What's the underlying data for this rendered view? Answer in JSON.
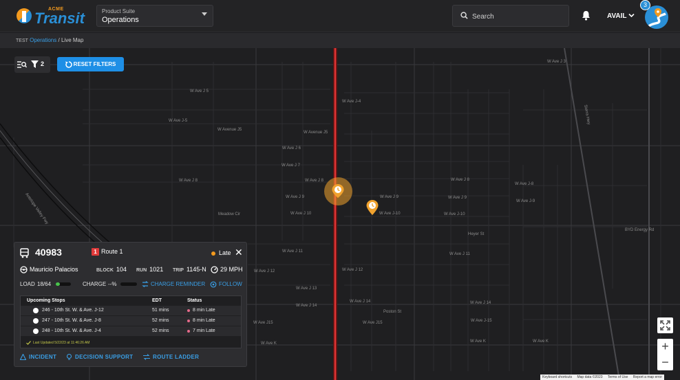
{
  "header": {
    "brand_small": "ACME",
    "brand_large": "Transit",
    "suite_label": "Product Suite",
    "suite_value": "Operations",
    "search_placeholder": "Search",
    "user_status": "AVAIL",
    "notification_badge": "3"
  },
  "breadcrumb": {
    "prefix": "TEST",
    "parent": "Operations",
    "separator": "/",
    "current": "Live Map"
  },
  "map_toolbar": {
    "filter_count": "2",
    "reset_label": "RESET FILTERS"
  },
  "map": {
    "street_labels": [
      "W Ave J 3",
      "W Ave J-4",
      "W Ave J 5",
      "W Ave J-5",
      "W Avenue J5",
      "W Avenue J5",
      "W Ave J 6",
      "W Ave J 7",
      "W Ave J 8",
      "W Ave J 8",
      "W Ave J 8",
      "W Ave J-8",
      "W Ave J 9",
      "W Ave J 9",
      "W Ave J 9",
      "W Ave J-9",
      "W Ave J 10",
      "W Ave J-10",
      "W Ave J-10",
      "Meadow Cir",
      "Heyer St",
      "BYD Energy Rd",
      "W Ave J 11",
      "W Ave J 11",
      "W Ave J 12",
      "W Ave J 12",
      "W Ave J 13",
      "W Ave J 14",
      "W Ave J 14",
      "W Ave J 14",
      "Poston St",
      "W Ave J15",
      "W Ave J15",
      "W Ave J-15",
      "W Ave K",
      "W Ave K",
      "W Ave K",
      "Antelope Valley Fwy",
      "Sierra Hwy"
    ],
    "attribution": [
      "Keyboard shortcuts",
      "Map data ©2023",
      "Terms of Use",
      "Report a map error"
    ],
    "zoom_in": "+",
    "zoom_out": "−"
  },
  "vehicle_panel": {
    "vehicle_id": "40983",
    "route_number": "1",
    "route_label": "Route 1",
    "status": "Late",
    "driver": "Mauricio Palacios",
    "block_label": "BLOCK",
    "block_value": "104",
    "run_label": "RUN",
    "run_value": "1021",
    "trip_label": "TRIP",
    "trip_value": "1145-N",
    "speed": "29 MPH",
    "load_label": "LOAD",
    "load_value": "18/64",
    "load_fraction": 0.28,
    "charge_label": "CHARGE",
    "charge_value": "--%",
    "charge_reminder_label": "CHARGE REMINDER",
    "follow_label": "FOLLOW",
    "stops_headers": {
      "stop": "Upcoming Stops",
      "edt": "EDT",
      "status": "Status"
    },
    "stops": [
      {
        "stop": "246 - 10th St. W. & Ave. J-12",
        "edt": "51 mins",
        "status": "8 min Late"
      },
      {
        "stop": "247 - 10th St. W. & Ave. J-8",
        "edt": "52 mins",
        "status": "8 min Late"
      },
      {
        "stop": "248 - 10th St. W. & Ave. J-4",
        "edt": "52 mins",
        "status": "7 min Late"
      }
    ],
    "last_updated": "Last Updated 5/22/23 at 11:46:26 AM",
    "actions": {
      "incident": "INCIDENT",
      "decision_support": "DECISION SUPPORT",
      "route_ladder": "ROUTE LADDER"
    }
  },
  "colors": {
    "accent": "#1e8fe6",
    "route": "#e03a3a",
    "late": "#f39a1e",
    "pin": "#f0a22e"
  }
}
